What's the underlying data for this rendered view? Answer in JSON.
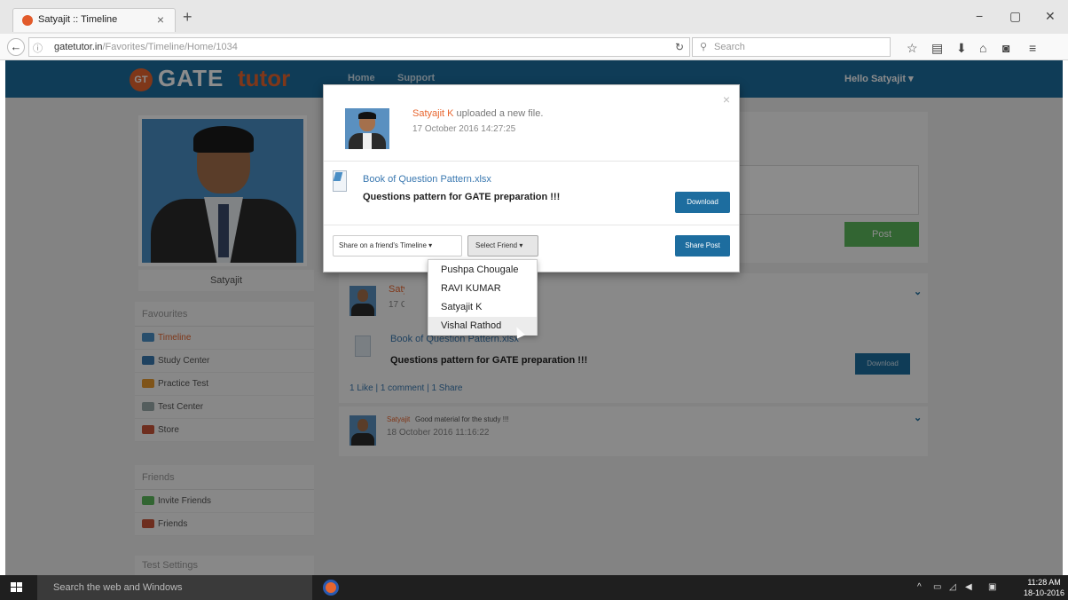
{
  "browser": {
    "tab_title": "Satyajit :: Timeline",
    "tab_close": "×",
    "new_tab": "+",
    "url_host": "gatetutor.in",
    "url_path": "/Favorites/Timeline/Home/1034",
    "search_placeholder": "Search",
    "win_min": "−",
    "win_max": "▢",
    "win_close": "✕"
  },
  "site": {
    "logo_badge": "GT",
    "logo_word1": "GATE",
    "logo_word2": "tutor",
    "nav": [
      "Home",
      "Support"
    ],
    "greeting": "Hello Satyajit ▾"
  },
  "sidebar": {
    "profile_name": "Satyajit",
    "favourites_head": "Favourites",
    "favourites": [
      "Timeline",
      "Study Center",
      "Practice Test",
      "Test Center",
      "Store"
    ],
    "friends_head": "Friends",
    "friends": [
      "Invite Friends",
      "Friends"
    ],
    "settings_head": "Test Settings"
  },
  "compose": {
    "post_label": "Post"
  },
  "feed": {
    "post1": {
      "user": "Satyajit",
      "date": "17 Octo",
      "file_name": "Book of Question Pattern.xlsx",
      "file_desc": "Questions pattern for GATE preparation !!!",
      "download_label": "Download",
      "stats": "1 Like | 1 comment | 1 Share"
    },
    "post2": {
      "user": "Satyajit",
      "text": "Good material for the study !!!",
      "date": "18 October 2016 11:16:22"
    }
  },
  "modal": {
    "close": "×",
    "user": "Satyajit K",
    "action": " uploaded a new file.",
    "date": "17 October 2016 14:27:25",
    "file_name": "Book of Question Pattern.xlsx",
    "file_desc": "Questions pattern for GATE preparation !!!",
    "download_label": "Download",
    "share_dropdown": "Share on a friend's Timeline ▾",
    "friend_dropdown": "Select Friend ▾",
    "share_post_label": "Share Post"
  },
  "friend_options": [
    "Pushpa Chougale",
    "RAVI KUMAR",
    "Satyajit K",
    "Vishal Rathod"
  ],
  "highlighted_option": "Vishal Rathod",
  "taskbar": {
    "search_placeholder": "Search the web and Windows",
    "time": "11:28 AM",
    "date": "18-10-2016"
  }
}
